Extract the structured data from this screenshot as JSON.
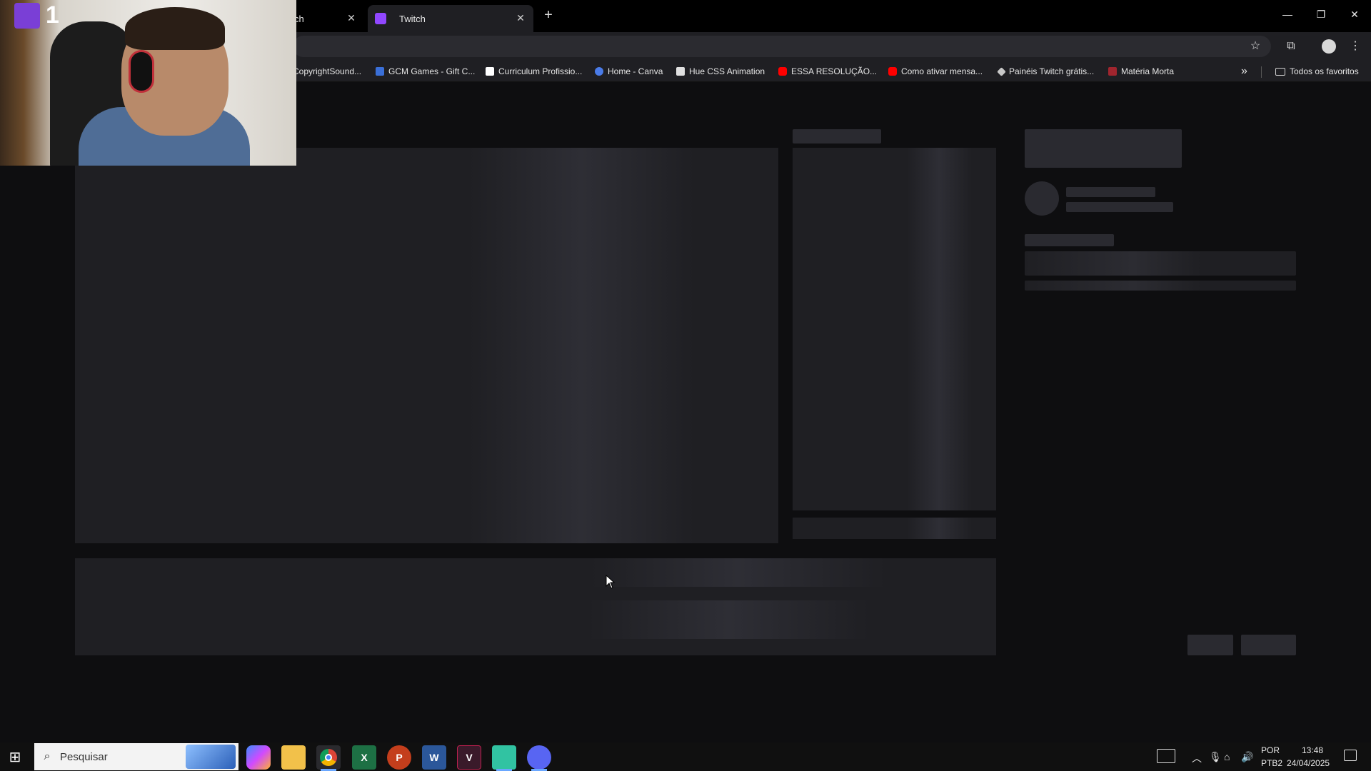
{
  "browser": {
    "tabs": [
      {
        "label": "ch"
      },
      {
        "label": "Twitch"
      }
    ],
    "window_controls": {
      "minimize": "—",
      "restore": "❐",
      "close": "✕"
    },
    "new_tab_glyph": "+",
    "toolbar_icons": [
      "star-icon",
      "extensions-icon",
      "profile-icon",
      "menu-icon"
    ]
  },
  "bookmarks": {
    "items": [
      {
        "label": "CopyrightSound...",
        "color": "#ffffff"
      },
      {
        "label": "GCM Games - Gift C...",
        "color": "#3a6fd8"
      },
      {
        "label": "Curriculum Profissio...",
        "color": "#ffffff"
      },
      {
        "label": "Home - Canva",
        "color": "#4a7be8"
      },
      {
        "label": "Hue CSS Animation",
        "color": "#e0e0e0"
      },
      {
        "label": "ESSA RESOLUÇÃO...",
        "color": "#ff0000"
      },
      {
        "label": "Como ativar mensa...",
        "color": "#ff0000"
      },
      {
        "label": "Painéis Twitch grátis...",
        "color": "#c8c8c8"
      },
      {
        "label": "Matéria Morta",
        "color": "#a0252e"
      }
    ],
    "overflow_glyph": "»",
    "all_bookmarks": "Todos os favoritos"
  },
  "webcam": {
    "overlay_number": "1"
  },
  "taskbar": {
    "search_placeholder": "Pesquisar",
    "apps": [
      "copilot-icon",
      "file-explorer-icon",
      "chrome-icon",
      "excel-icon",
      "powerpoint-icon",
      "word-icon",
      "vectorizer-icon",
      "streamlabs-icon",
      "discord-icon"
    ],
    "language": "POR",
    "layout": "PTB2",
    "time": "13:48",
    "date": "24/04/2025"
  },
  "colors": {
    "page_bg": "#0e0e10",
    "skeleton": "#1f1f23",
    "twitch_purple": "#9147ff"
  }
}
